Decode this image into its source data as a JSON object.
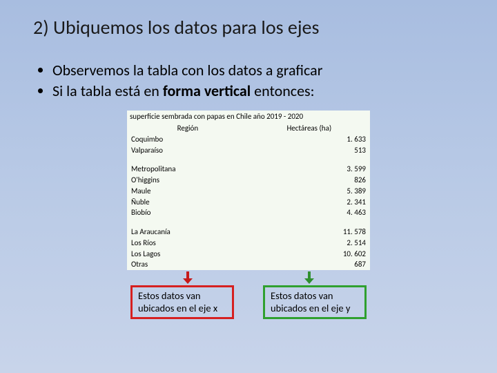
{
  "title": "2) Ubiquemos los datos para los ejes",
  "bullets": {
    "a": "Observemos la tabla con los datos a graficar",
    "b_pre": "Si la tabla está en ",
    "b_bold": "forma vertical",
    "b_post": " entonces:"
  },
  "table": {
    "caption": "superficie sembrada con papas en Chile año 2019 - 2020",
    "col_region": "Región",
    "col_hect": "Hectáreas (ha)",
    "rows": {
      "g1r1_r": "Coquimbo",
      "g1r1_v": "1. 633",
      "g1r2_r": "Valparaíso",
      "g1r2_v": "513",
      "g2r1_r": "Metropolitana",
      "g2r1_v": "3. 599",
      "g2r2_r": "O'higgins",
      "g2r2_v": "826",
      "g2r3_r": "Maule",
      "g2r3_v": "5. 389",
      "g2r4_r": "Ñuble",
      "g2r4_v": "2. 341",
      "g2r5_r": "Biobío",
      "g2r5_v": "4. 463",
      "g3r1_r": "La Araucanía",
      "g3r1_v": "11. 578",
      "g3r2_r": "Los Ríos",
      "g3r2_v": "2. 514",
      "g3r3_r": "Los Lagos",
      "g3r3_v": "10. 602",
      "g3r4_r": "Otras",
      "g3r4_v": "687"
    }
  },
  "caption_x": "Estos datos van ubicados  en el eje x",
  "caption_y": "Estos datos van ubicados  en el eje y",
  "chart_data": {
    "type": "table",
    "title": "superficie sembrada con papas en Chile año 2019 - 2020",
    "xlabel": "Región",
    "ylabel": "Hectáreas (ha)",
    "categories": [
      "Coquimbo",
      "Valparaíso",
      "Metropolitana",
      "O'higgins",
      "Maule",
      "Ñuble",
      "Biobío",
      "La Araucanía",
      "Los Ríos",
      "Los Lagos",
      "Otras"
    ],
    "values": [
      1633,
      513,
      3599,
      826,
      5389,
      2341,
      4463,
      11578,
      2514,
      10602,
      687
    ]
  }
}
